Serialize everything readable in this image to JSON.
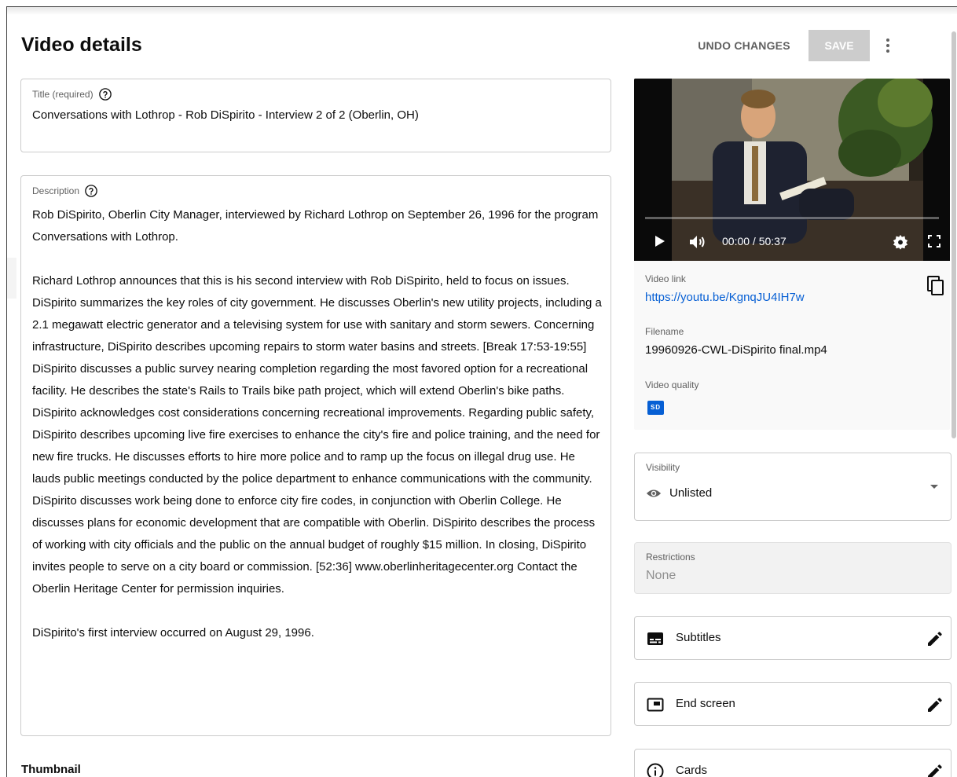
{
  "header": {
    "title": "Video details",
    "undo_label": "UNDO CHANGES",
    "save_label": "SAVE",
    "more_icon": "more-vert-icon"
  },
  "title_field": {
    "label": "Title (required)",
    "value": "Conversations with Lothrop - Rob DiSpirito - Interview 2 of 2 (Oberlin, OH)",
    "help_icon": "help-circle-icon"
  },
  "description_field": {
    "label": "Description",
    "help_icon": "help-circle-icon",
    "paragraphs": [
      "Rob DiSpirito, Oberlin City Manager, interviewed by Richard Lothrop on September 26, 1996 for the program Conversations with Lothrop.",
      "Richard Lothrop announces that this is his second interview with Rob DiSpirito, held to focus on issues. DiSpirito summarizes the key roles of city government. He discusses Oberlin's new utility projects, including a 2.1 megawatt electric generator and a televising system for use with sanitary and storm sewers. Concerning infrastructure, DiSpirito describes upcoming repairs to storm water basins and streets. [Break 17:53-19:55] DiSpirito discusses a public survey nearing completion regarding the most favored option for a recreational facility. He describes the state's Rails to Trails bike path project, which will extend Oberlin's bike paths. DiSpirito acknowledges cost considerations concerning recreational improvements. Regarding public safety, DiSpirito describes upcoming live fire exercises to enhance the city's fire and police training, and the need for new fire trucks. He discusses efforts to hire more police and to ramp up the focus on illegal drug use. He lauds public meetings conducted by the police department to enhance communications with the community. DiSpirito discusses work being done to enforce city fire codes, in conjunction with Oberlin College. He discusses plans for economic development that are compatible with Oberlin. DiSpirito describes the process of working with city officials and the public on the annual budget of roughly $15 million. In closing, DiSpirito invites people to serve on a city board or commission. [52:36] www.oberlinheritagecenter.org Contact the Oberlin Heritage Center for permission inquiries.",
      "DiSpirito's first interview occurred on August 29, 1996."
    ]
  },
  "thumbnail": {
    "heading": "Thumbnail"
  },
  "video": {
    "time": "00:00 / 50:37",
    "progress": 0,
    "link_label": "Video link",
    "link": "https://youtu.be/KgnqJU4IH7w",
    "filename_label": "Filename",
    "filename": "19960926-CWL-DiSpirito final.mp4",
    "quality_label": "Video quality",
    "quality_badge": "SD"
  },
  "visibility": {
    "label": "Visibility",
    "value": "Unlisted",
    "icon": "eye-icon"
  },
  "restrictions": {
    "label": "Restrictions",
    "value": "None"
  },
  "features": {
    "subtitles": "Subtitles",
    "end_screen": "End screen",
    "cards": "Cards"
  },
  "colors": {
    "accent": "#065fd4",
    "save_disabled": "#cccccc",
    "muted_text": "#606060"
  }
}
